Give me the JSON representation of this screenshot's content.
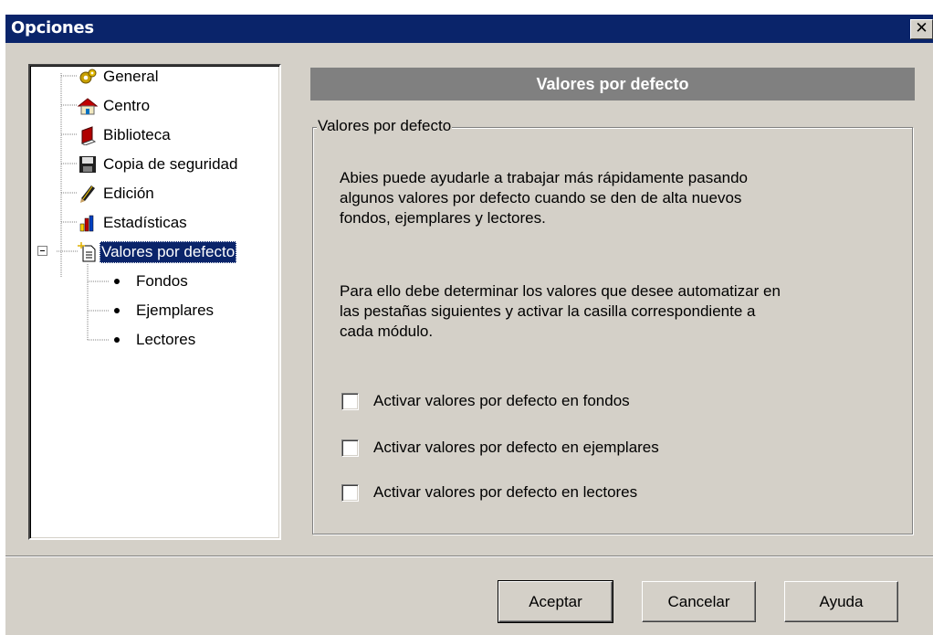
{
  "window": {
    "title": "Opciones",
    "close_glyph": "✕"
  },
  "tree": {
    "items": [
      {
        "label": "General",
        "icon": "gear-icon"
      },
      {
        "label": "Centro",
        "icon": "house-icon"
      },
      {
        "label": "Biblioteca",
        "icon": "book-icon"
      },
      {
        "label": "Copia de seguridad",
        "icon": "floppy-disk-icon"
      },
      {
        "label": "Edición",
        "icon": "pencil-icon"
      },
      {
        "label": "Estadísticas",
        "icon": "bar-chart-icon"
      },
      {
        "label": "Valores por defecto",
        "icon": "new-document-icon",
        "selected": true,
        "expanded": true,
        "children": [
          "Fondos",
          "Ejemplares",
          "Lectores"
        ]
      }
    ]
  },
  "panel": {
    "header": "Valores por defecto",
    "group_label": "Valores por defecto",
    "paragraph1_lines": [
      "Abies puede ayudarle a trabajar más rápidamente pasando",
      "algunos valores por defecto cuando se den de alta nuevos",
      "fondos, ejemplares y lectores."
    ],
    "paragraph2_lines": [
      "Para ello debe determinar los valores que desee automatizar en",
      "las pestañas siguientes y activar la casilla correspondiente a",
      "cada módulo."
    ],
    "checkboxes": [
      {
        "label": "Activar valores por defecto en fondos",
        "checked": false
      },
      {
        "label": "Activar valores por defecto en ejemplares",
        "checked": false
      },
      {
        "label": "Activar valores por defecto en lectores",
        "checked": false
      }
    ]
  },
  "buttons": {
    "ok": "Aceptar",
    "cancel": "Cancelar",
    "help": "Ayuda"
  },
  "colors": {
    "titlebar": "#0a246a",
    "face": "#d4d0c8",
    "header": "#808080",
    "selection": "#0a246a"
  }
}
